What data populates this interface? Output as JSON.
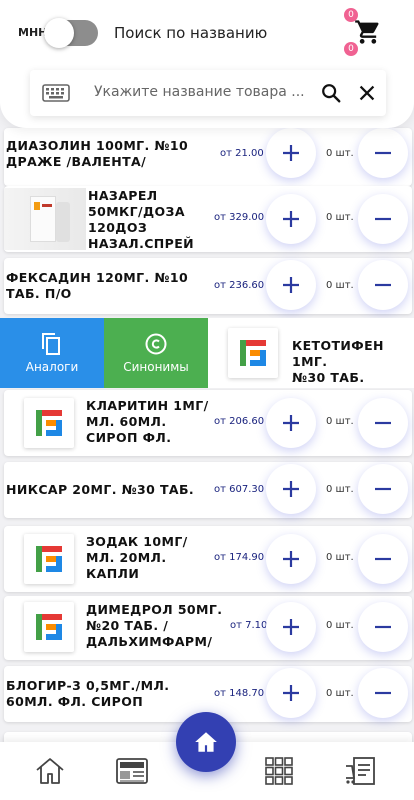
{
  "header": {
    "mnn_label": "МНН",
    "search_by_name_label": "Поиск по названию",
    "cart_badge_top": "0",
    "cart_badge_bottom": "0",
    "search_placeholder": "Укажите название товара ..."
  },
  "swipe_actions": {
    "analogs": "Аналоги",
    "synonyms": "Синонимы"
  },
  "products": [
    {
      "name": "ДИАЗОЛИН 100МГ. №10\nДРАЖЕ /ВАЛЕНТА/",
      "price": "от 21.00",
      "qty": "0 шт."
    },
    {
      "name": "НАЗАРЕЛ\n50МКГ/ДОЗА\n120ДОЗ\nНАЗАЛ.СПРЕЙ",
      "price": "от 329.00",
      "qty": "0 шт."
    },
    {
      "name": "ФЕКСАДИН 120МГ. №10\nТАБ. П/О",
      "price": "от 236.60",
      "qty": "0 шт."
    },
    {
      "name": "КЕТОТИФЕН 1МГ.\n№30 ТАБ.",
      "price": "",
      "qty": ""
    },
    {
      "name": "КЛАРИТИН 1МГ/\nМЛ. 60МЛ.\nСИРОП ФЛ.",
      "price": "от 206.60",
      "qty": "0 шт."
    },
    {
      "name": "НИКСАР 20МГ. №30 ТАБ.",
      "price": "от 607.30",
      "qty": "0 шт."
    },
    {
      "name": "ЗОДАК 10МГ/\nМЛ. 20МЛ.\nКАПЛИ",
      "price": "от 174.90",
      "qty": "0 шт."
    },
    {
      "name": "ДИМЕДРОЛ 50МГ.\n№20 ТАБ. /\nДАЛЬХИМФАРМ/",
      "price": "от 7.10",
      "qty": "0 шт."
    },
    {
      "name": "БЛОГИР-3 0,5МГ./МЛ.\n60МЛ. ФЛ. СИРОП",
      "price": "от 148.70",
      "qty": "0 шт."
    }
  ],
  "icons": {
    "keyboard": "keyboard-icon",
    "search": "search-icon",
    "close": "close-icon",
    "cart": "cart-icon",
    "plus": "plus-icon",
    "minus": "minus-icon",
    "home": "home-icon",
    "news": "news-icon",
    "grid": "grid-icon",
    "orders": "orders-icon",
    "copy": "copy-icon",
    "copyright": "copyright-icon"
  },
  "colors": {
    "accent": "#3340b2",
    "analogs": "#2a8fe8",
    "synonyms": "#4caf50",
    "badge": "#f06292",
    "price": "#1a237e"
  }
}
